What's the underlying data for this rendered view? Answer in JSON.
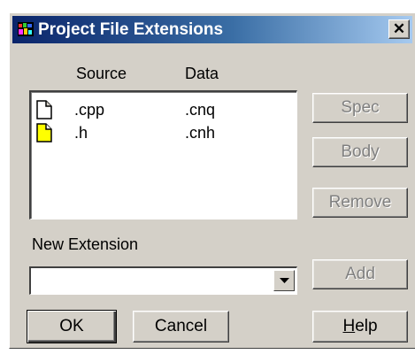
{
  "window": {
    "title": "Project File Extensions",
    "close_glyph": "✕"
  },
  "list": {
    "headers": {
      "source": "Source",
      "data": "Data"
    },
    "rows": [
      {
        "source": ".cpp",
        "data": ".cnq",
        "icon": "document-icon"
      },
      {
        "source": ".h",
        "data": ".cnh",
        "icon": "header-document-icon"
      }
    ]
  },
  "side_buttons": {
    "spec": "Spec",
    "body": "Body",
    "remove": "Remove",
    "add": "Add",
    "help_underlined": "H",
    "help_rest": "elp"
  },
  "new_extension": {
    "label": "New Extension",
    "value": ""
  },
  "bottom_buttons": {
    "ok": "OK",
    "cancel": "Cancel"
  },
  "colors": {
    "title_bar": "#0a246a",
    "dialog_face": "#d4d0c8",
    "disabled_text": "#808080",
    "header_icon_fill": "#ffff00"
  }
}
